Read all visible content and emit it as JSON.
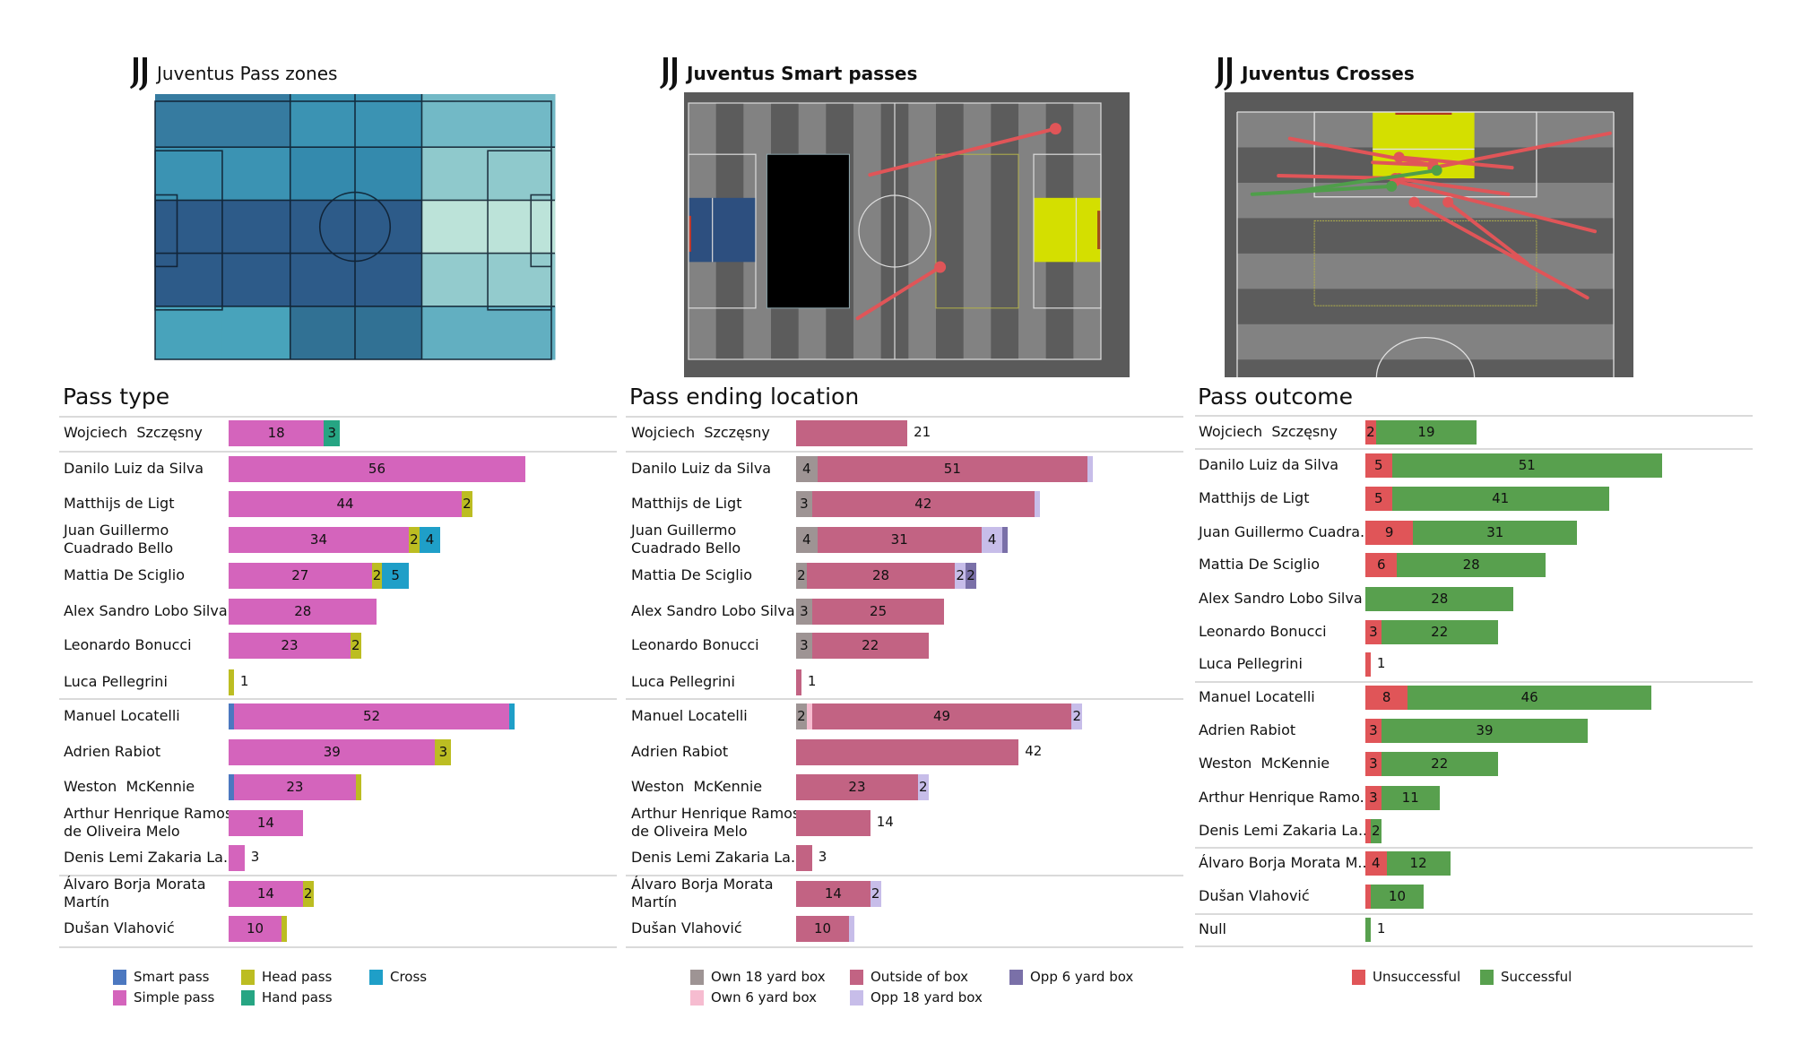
{
  "panels": {
    "pass_zones": {
      "title": "Juventus Pass zones",
      "logo": "juventus-logo-icon"
    },
    "smart_passes": {
      "title": "Juventus Smart passes",
      "logo": "juventus-logo-icon"
    },
    "crosses": {
      "title": "Juventus Crosses",
      "logo": "juventus-logo-icon"
    }
  },
  "chart_data": [
    {
      "type": "heatmap",
      "title": "Juventus Pass zones",
      "description": "Pitch divided into zones (columns left-to-right x rows top-to-bottom); relative intensity 0-1 (darker = more passes)",
      "columns": 5,
      "rows": 5,
      "intensity": [
        [
          0.7,
          0.7,
          0.55,
          0.55,
          0.35
        ],
        [
          0.55,
          0.55,
          0.62,
          0.62,
          0.22
        ],
        [
          0.95,
          0.95,
          0.95,
          0.95,
          0.05
        ],
        [
          0.95,
          0.95,
          0.95,
          0.95,
          0.2
        ],
        [
          0.45,
          0.45,
          0.75,
          0.75,
          0.38
        ]
      ],
      "colors": {
        "0.05": "#bce3d9",
        "0.20": "#93cbcd",
        "0.22": "#8fc9cc",
        "0.35": "#72b9c6",
        "0.38": "#62afc1",
        "0.45": "#48a3bb",
        "0.55": "#3b93b3",
        "0.62": "#348aad",
        "0.70": "#367ba0",
        "0.75": "#317194",
        "0.95": "#2d5b89"
      }
    },
    {
      "type": "scatter",
      "title": "Juventus Smart passes",
      "description": "Pass arrows on full pitch, coordinates in pitch percent (x 0-100 left to right, y 0-100 top to bottom); dot = end point",
      "highlight_zones": {
        "own_6_yard_box": "#2d4f7f",
        "opp_6_yard_box": "#d4df00"
      },
      "passes": [
        {
          "start": [
            44,
            28
          ],
          "end": [
            89,
            10
          ],
          "outcome": "unsuccessful"
        },
        {
          "start": [
            41,
            84
          ],
          "end": [
            61,
            64
          ],
          "outcome": "unsuccessful"
        }
      ]
    },
    {
      "type": "scatter",
      "title": "Juventus Crosses",
      "description": "Cross arrows on attacking half (rotated, goal at top), coordinates in half-pitch percent (x 0-100 across, y 0-100 from goal line); dot = end point",
      "passes": [
        {
          "start": [
            14,
            10
          ],
          "end": [
            52,
            20
          ],
          "outcome": "unsuccessful"
        },
        {
          "start": [
            99,
            8
          ],
          "end": [
            52,
            21
          ],
          "outcome": "unsuccessful"
        },
        {
          "start": [
            36,
            19
          ],
          "end": [
            52,
            20
          ],
          "outcome": "unsuccessful"
        },
        {
          "start": [
            73,
            21
          ],
          "end": [
            43,
            17
          ],
          "outcome": "unsuccessful"
        },
        {
          "start": [
            11,
            24
          ],
          "end": [
            43,
            25
          ],
          "outcome": "unsuccessful"
        },
        {
          "start": [
            72,
            31
          ],
          "end": [
            42,
            25
          ],
          "outcome": "unsuccessful"
        },
        {
          "start": [
            95,
            45
          ],
          "end": [
            42,
            26
          ],
          "outcome": "unsuccessful"
        },
        {
          "start": [
            93,
            70
          ],
          "end": [
            47,
            34
          ],
          "outcome": "unsuccessful"
        },
        {
          "start": [
            77,
            57
          ],
          "end": [
            56,
            34
          ],
          "outcome": "unsuccessful"
        },
        {
          "start": [
            4,
            31
          ],
          "end": [
            41,
            28
          ],
          "outcome": "successful"
        },
        {
          "start": [
            15,
            30
          ],
          "end": [
            53,
            22
          ],
          "outcome": "successful"
        }
      ]
    },
    {
      "type": "bar",
      "orientation": "horizontal-stacked",
      "title": "Pass type",
      "series_names": [
        "Smart pass",
        "Simple pass",
        "Head pass",
        "Hand pass",
        "Cross"
      ],
      "series_colors": [
        "#4c78c0",
        "#d464bc",
        "#bcbd22",
        "#26a583",
        "#1f9fc8"
      ],
      "players": [
        {
          "name": "Wojciech  Szczęsny",
          "values": [
            0,
            18,
            0,
            3,
            0
          ],
          "group": 0
        },
        {
          "name": "Danilo Luiz da Silva",
          "values": [
            0,
            56,
            0,
            0,
            0
          ],
          "group": 1
        },
        {
          "name": "Matthijs de Ligt",
          "values": [
            0,
            44,
            2,
            0,
            0
          ],
          "group": 1
        },
        {
          "name": "Juan Guillermo\nCuadrado Bello",
          "values": [
            0,
            34,
            2,
            0,
            4
          ],
          "group": 1
        },
        {
          "name": "Mattia De Sciglio",
          "values": [
            0,
            27,
            2,
            0,
            5
          ],
          "group": 1
        },
        {
          "name": "Alex Sandro Lobo Silva",
          "values": [
            0,
            28,
            0,
            0,
            0
          ],
          "group": 1
        },
        {
          "name": "Leonardo Bonucci",
          "values": [
            0,
            23,
            2,
            0,
            0
          ],
          "group": 1
        },
        {
          "name": "Luca Pellegrini",
          "values": [
            0,
            0,
            1,
            0,
            0
          ],
          "group": 1
        },
        {
          "name": "Manuel Locatelli",
          "values": [
            1,
            52,
            0,
            0,
            1
          ],
          "group": 2
        },
        {
          "name": "Adrien Rabiot",
          "values": [
            0,
            39,
            3,
            0,
            0
          ],
          "group": 2
        },
        {
          "name": "Weston  McKennie",
          "values": [
            1,
            23,
            1,
            0,
            0
          ],
          "group": 2
        },
        {
          "name": "Arthur Henrique Ramos\nde Oliveira Melo",
          "values": [
            0,
            14,
            0,
            0,
            0
          ],
          "group": 2
        },
        {
          "name": "Denis Lemi Zakaria La..",
          "values": [
            0,
            3,
            0,
            0,
            0
          ],
          "group": 2
        },
        {
          "name": "Álvaro Borja Morata\nMartín",
          "values": [
            0,
            14,
            2,
            0,
            0
          ],
          "group": 3
        },
        {
          "name": "Dušan Vlahović",
          "values": [
            0,
            10,
            1,
            0,
            0
          ],
          "group": 3
        }
      ],
      "xlim": [
        0,
        56
      ]
    },
    {
      "type": "bar",
      "orientation": "horizontal-stacked",
      "title": "Pass ending location",
      "series_names": [
        "Own 18 yard box",
        "Own 6 yard box",
        "Outside of box",
        "Opp 18 yard box",
        "Opp 6 yard box"
      ],
      "series_colors": [
        "#9e9494",
        "#f6bcd0",
        "#c26383",
        "#c7bde9",
        "#7a70a8"
      ],
      "players": [
        {
          "name": "Wojciech  Szczęsny",
          "values": [
            0,
            0,
            21,
            0,
            0
          ],
          "group": 0
        },
        {
          "name": "Danilo Luiz da Silva",
          "values": [
            4,
            0,
            51,
            1,
            0
          ],
          "group": 1
        },
        {
          "name": "Matthijs de Ligt",
          "values": [
            3,
            0,
            42,
            1,
            0
          ],
          "group": 1
        },
        {
          "name": "Juan Guillermo\nCuadrado Bello",
          "values": [
            4,
            0,
            31,
            4,
            1
          ],
          "group": 1
        },
        {
          "name": "Mattia De Sciglio",
          "values": [
            2,
            0,
            28,
            2,
            2
          ],
          "group": 1
        },
        {
          "name": "Alex Sandro Lobo Silva",
          "values": [
            3,
            0,
            25,
            0,
            0
          ],
          "group": 1
        },
        {
          "name": "Leonardo Bonucci",
          "values": [
            3,
            0,
            22,
            0,
            0
          ],
          "group": 1
        },
        {
          "name": "Luca Pellegrini",
          "values": [
            0,
            0,
            1,
            0,
            0
          ],
          "group": 1
        },
        {
          "name": "Manuel Locatelli",
          "values": [
            2,
            1,
            49,
            2,
            0
          ],
          "group": 2
        },
        {
          "name": "Adrien Rabiot",
          "values": [
            0,
            0,
            42,
            0,
            0
          ],
          "group": 2
        },
        {
          "name": "Weston  McKennie",
          "values": [
            0,
            0,
            23,
            2,
            0
          ],
          "group": 2
        },
        {
          "name": "Arthur Henrique Ramos\nde Oliveira Melo",
          "values": [
            0,
            0,
            14,
            0,
            0
          ],
          "group": 2
        },
        {
          "name": "Denis Lemi Zakaria La..",
          "values": [
            0,
            0,
            3,
            0,
            0
          ],
          "group": 2
        },
        {
          "name": "Álvaro Borja Morata\nMartín",
          "values": [
            0,
            0,
            14,
            2,
            0
          ],
          "group": 3
        },
        {
          "name": "Dušan Vlahović",
          "values": [
            0,
            0,
            10,
            1,
            0
          ],
          "group": 3
        }
      ],
      "xlim": [
        0,
        56
      ]
    },
    {
      "type": "bar",
      "orientation": "horizontal-stacked",
      "title": "Pass outcome",
      "series_names": [
        "Unsuccessful",
        "Successful"
      ],
      "series_colors": [
        "#e05558",
        "#58a04e"
      ],
      "players": [
        {
          "name": "Wojciech  Szczęsny",
          "values": [
            2,
            19
          ],
          "group": 0
        },
        {
          "name": "Danilo Luiz da Silva",
          "values": [
            5,
            51
          ],
          "group": 1
        },
        {
          "name": "Matthijs de Ligt",
          "values": [
            5,
            41
          ],
          "group": 1
        },
        {
          "name": "Juan Guillermo Cuadra..",
          "values": [
            9,
            31
          ],
          "group": 1
        },
        {
          "name": "Mattia De Sciglio",
          "values": [
            6,
            28
          ],
          "group": 1
        },
        {
          "name": "Alex Sandro Lobo Silva",
          "values": [
            0,
            28
          ],
          "group": 1
        },
        {
          "name": "Leonardo Bonucci",
          "values": [
            3,
            22
          ],
          "group": 1
        },
        {
          "name": "Luca Pellegrini",
          "values": [
            1,
            0
          ],
          "group": 1
        },
        {
          "name": "Manuel Locatelli",
          "values": [
            8,
            46
          ],
          "group": 2
        },
        {
          "name": "Adrien Rabiot",
          "values": [
            3,
            39
          ],
          "group": 2
        },
        {
          "name": "Weston  McKennie",
          "values": [
            3,
            22
          ],
          "group": 2
        },
        {
          "name": "Arthur Henrique Ramo..",
          "values": [
            3,
            11
          ],
          "group": 2
        },
        {
          "name": "Denis Lemi Zakaria La..",
          "values": [
            1,
            2
          ],
          "group": 2
        },
        {
          "name": "Álvaro Borja Morata M..",
          "values": [
            4,
            12
          ],
          "group": 3
        },
        {
          "name": "Dušan Vlahović",
          "values": [
            1,
            10
          ],
          "group": 3
        },
        {
          "name": "Null",
          "values": [
            0,
            1
          ],
          "group": 4
        }
      ],
      "xlim": [
        0,
        56
      ]
    }
  ]
}
